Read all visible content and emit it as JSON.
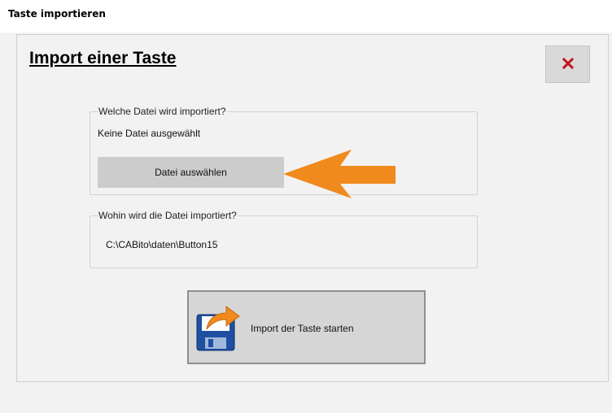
{
  "window": {
    "title": "Taste importieren"
  },
  "dialog": {
    "heading": "Import einer Taste",
    "close_icon": "close-icon",
    "source_group": {
      "legend": "Welche Datei wird importiert?",
      "file_status": "Keine Datei ausgewählt",
      "select_button": "Datei auswählen"
    },
    "target_group": {
      "legend": "Wohin wird die Datei importiert?",
      "path": "C:\\CABito\\daten\\Button15"
    },
    "import_button": {
      "label": "Import der Taste starten",
      "icon": "floppy-disk-import-icon"
    },
    "annotation": {
      "icon": "orange-arrow-left-icon",
      "color": "#F08A1C"
    }
  },
  "colors": {
    "close_x": "#C0161B",
    "arrow": "#F08A1C",
    "floppy": "#1F4FA0"
  }
}
